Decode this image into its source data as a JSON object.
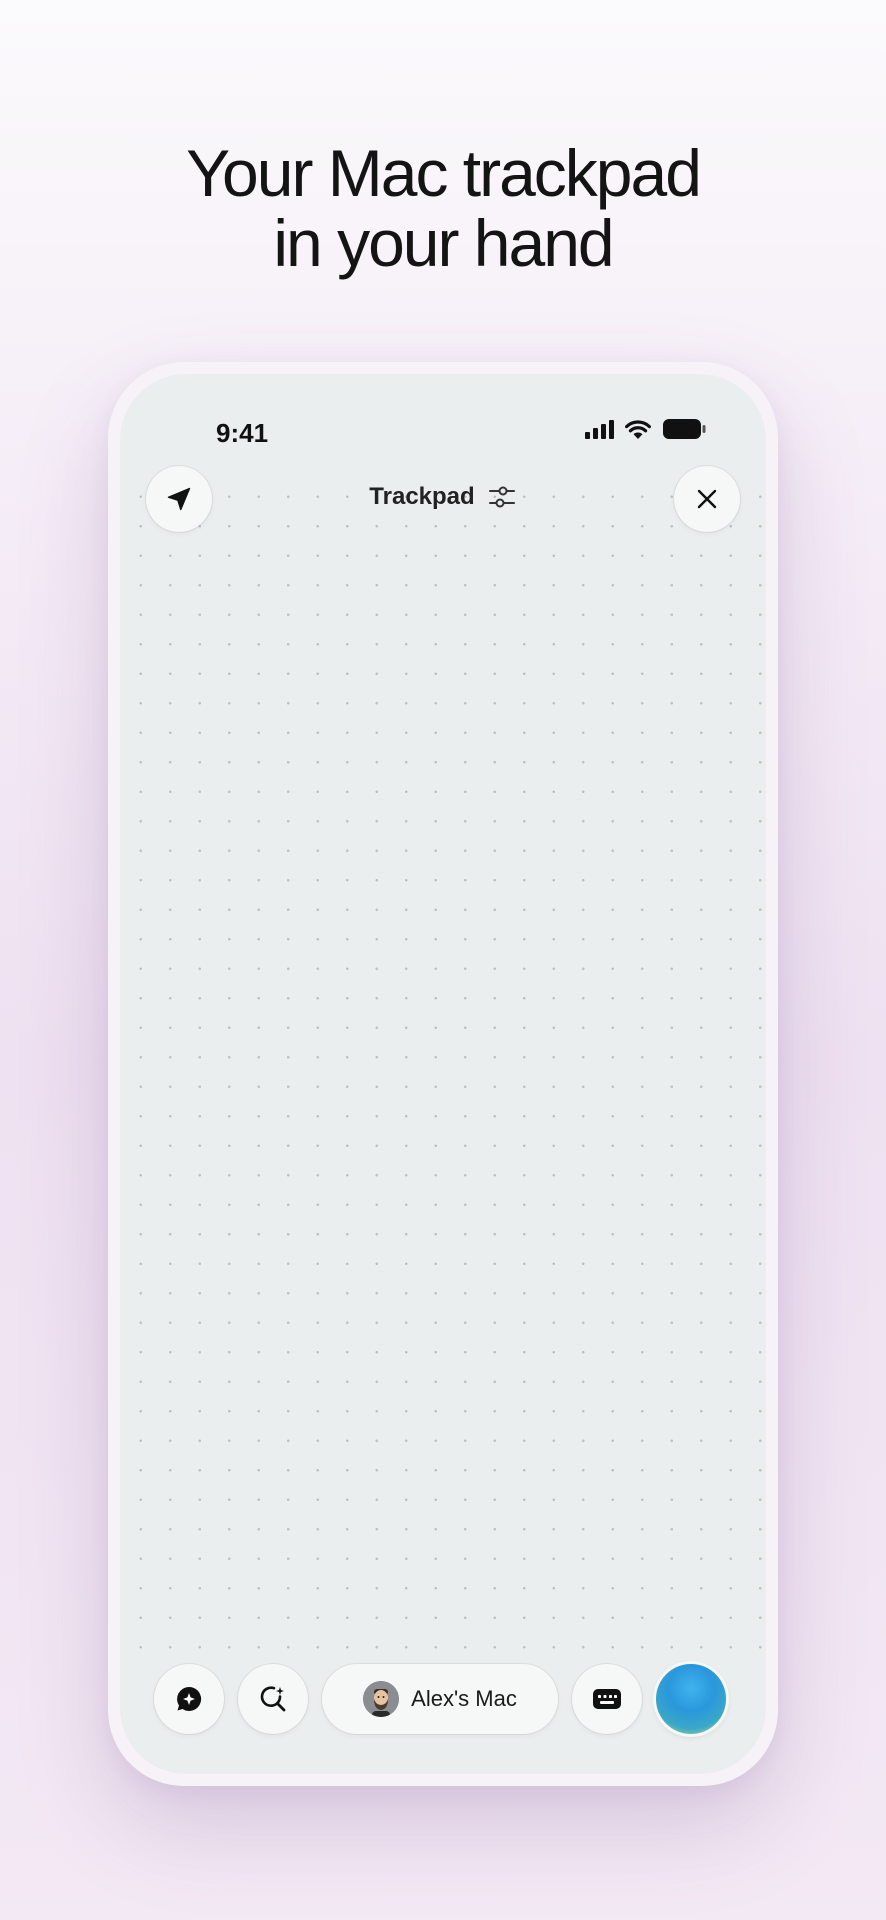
{
  "headline": {
    "line1": "Your Mac trackpad",
    "line2": "in your hand"
  },
  "status_bar": {
    "time": "9:41",
    "icons": [
      "cellular-signal-icon",
      "wifi-icon",
      "battery-icon"
    ]
  },
  "header": {
    "title": "Trackpad",
    "left_button_icon": "navigation-arrow-icon",
    "title_icon": "sliders-icon",
    "right_button_icon": "close-icon"
  },
  "bottom_bar": {
    "device_name": "Alex's Mac",
    "buttons": [
      "chat-sparkle-icon",
      "search-sparkle-icon",
      "keyboard-icon",
      "assistant-orb"
    ]
  },
  "colors": {
    "screen_bg": "#ebeeee",
    "button_bg": "#f6f7f7",
    "text": "#141414",
    "orb_blue": "#2a97dc"
  }
}
